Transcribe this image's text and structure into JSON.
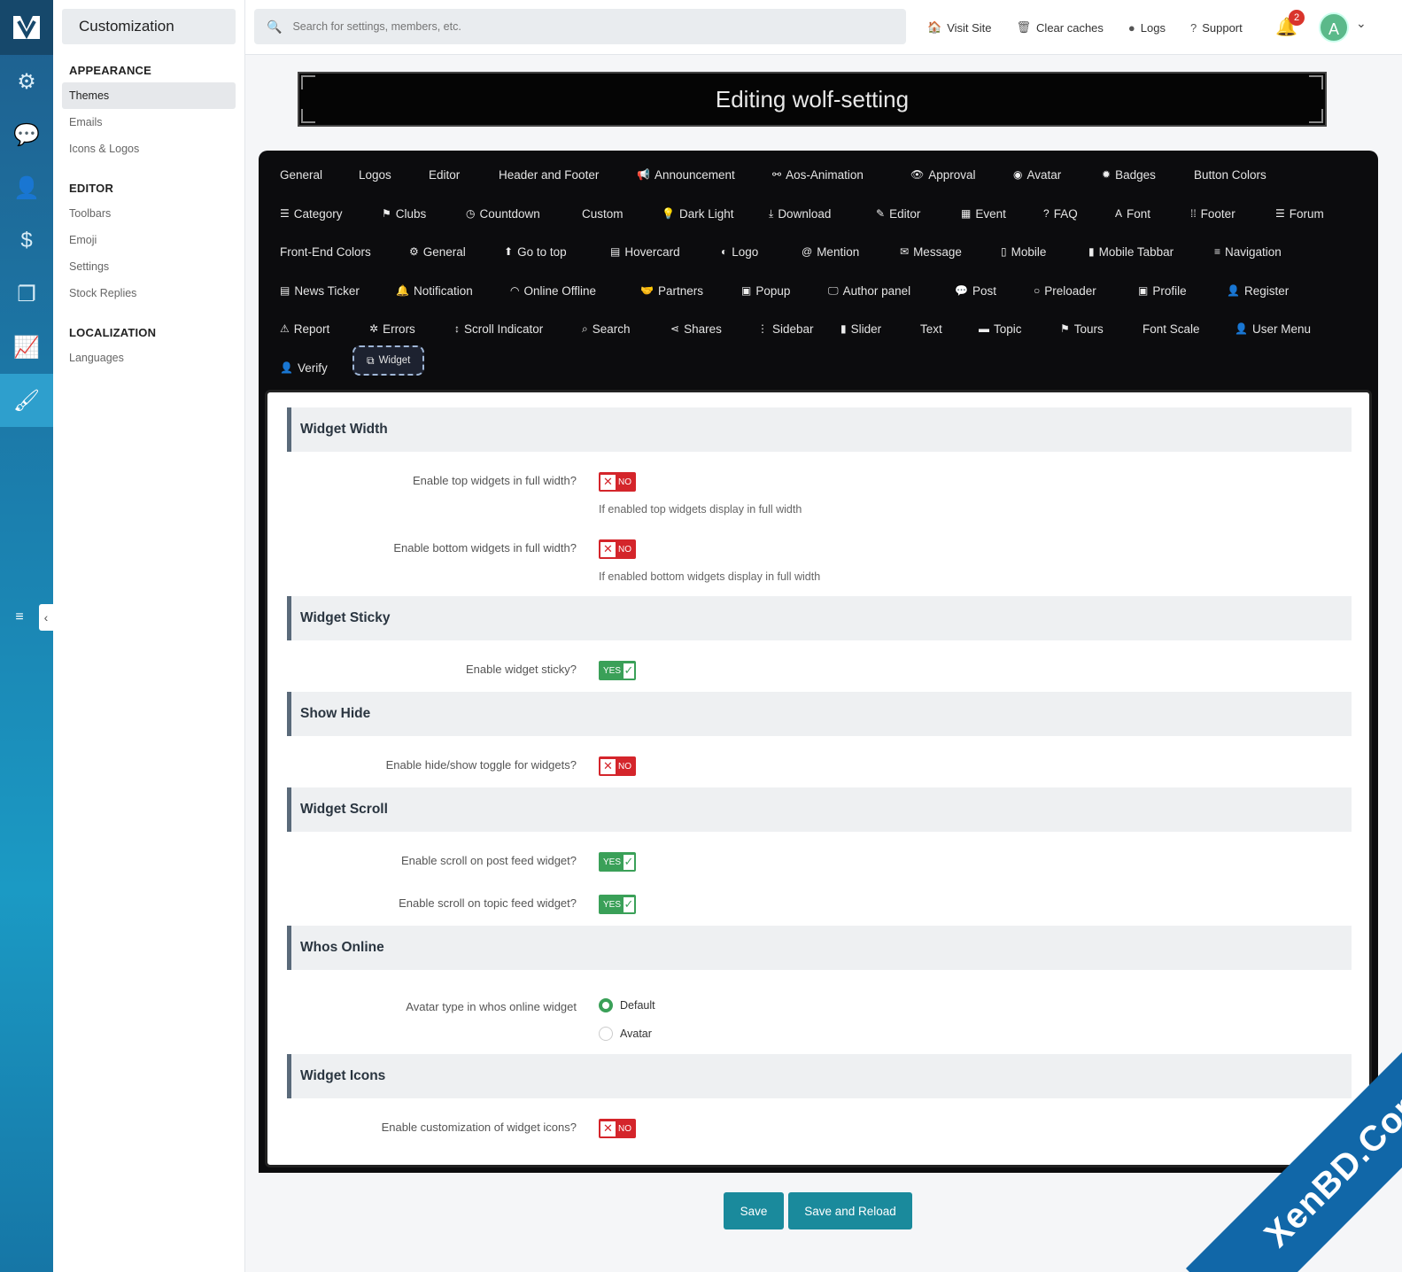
{
  "sidebar_rail": {
    "icons": [
      "logo-icon",
      "gear-icon",
      "chat-icon",
      "user-icon",
      "dollar-icon",
      "copy-icon",
      "chart-icon",
      "brush-icon"
    ]
  },
  "nav": {
    "title": "Customization",
    "sections": [
      {
        "label": "APPEARANCE",
        "items": [
          "Themes",
          "Emails",
          "Icons & Logos"
        ]
      },
      {
        "label": "EDITOR",
        "items": [
          "Toolbars",
          "Emoji",
          "Settings",
          "Stock Replies"
        ]
      },
      {
        "label": "LOCALIZATION",
        "items": [
          "Languages"
        ]
      }
    ],
    "active_item": "Themes"
  },
  "topbar": {
    "search_placeholder": "Search for settings, members, etc.",
    "links": [
      "Visit Site",
      "Clear caches",
      "Logs",
      "Support"
    ],
    "notification_count": "2",
    "avatar_letter": "A"
  },
  "banner": {
    "title": "Editing wolf-setting"
  },
  "tabs": {
    "row1": [
      "General",
      "Logos",
      "Editor",
      "Header and Footer",
      "Announcement",
      "Aos-Animation",
      "Approval",
      "Avatar",
      "Badges",
      "Button Colors"
    ],
    "row2": [
      "Category",
      "Clubs",
      "Countdown",
      "Custom",
      "Dark Light",
      "Download",
      "Editor",
      "Event",
      "FAQ",
      "Font",
      "Footer",
      "Forum"
    ],
    "row3": [
      "Front-End Colors",
      "General",
      "Go to top",
      "Hovercard",
      "Logo",
      "Mention",
      "Message",
      "Mobile",
      "Mobile Tabbar",
      "Navigation"
    ],
    "row4": [
      "News Ticker",
      "Notification",
      "Online Offline",
      "Partners",
      "Popup",
      "Author panel",
      "Post",
      "Preloader",
      "Profile",
      "Register"
    ],
    "row5": [
      "Report",
      "Errors",
      "Scroll Indicator",
      "Search",
      "Shares",
      "Sidebar",
      "Slider",
      "Text",
      "Topic",
      "Tours",
      "Font Scale",
      "User Menu"
    ],
    "row6": [
      "Verify",
      "Widget"
    ],
    "active": "Widget"
  },
  "sections": {
    "width": {
      "title": "Widget Width",
      "top_label": "Enable top widgets in full width?",
      "top_value": "NO",
      "top_hint": "If enabled top widgets display in full width",
      "bottom_label": "Enable bottom widgets in full width?",
      "bottom_value": "NO",
      "bottom_hint": "If enabled bottom widgets display in full width"
    },
    "sticky": {
      "title": "Widget Sticky",
      "label": "Enable widget sticky?",
      "value": "YES"
    },
    "showhide": {
      "title": "Show Hide",
      "label": "Enable hide/show toggle for widgets?",
      "value": "NO"
    },
    "scroll": {
      "title": "Widget Scroll",
      "post_label": "Enable scroll on post feed widget?",
      "post_value": "YES",
      "topic_label": "Enable scroll on topic feed widget?",
      "topic_value": "YES"
    },
    "online": {
      "title": "Whos Online",
      "label": "Avatar type in whos online widget",
      "options": [
        "Default",
        "Avatar"
      ],
      "selected": "Default"
    },
    "icons": {
      "title": "Widget Icons",
      "label": "Enable customization of widget icons?",
      "value": "NO"
    }
  },
  "buttons": {
    "save": "Save",
    "save_reload": "Save and Reload"
  },
  "watermark": {
    "text": "XenBD.Com"
  },
  "colors": {
    "accent": "#1a8a9c",
    "rail": "#1b7fae",
    "no": "#d4252b",
    "yes": "#3aa058"
  }
}
